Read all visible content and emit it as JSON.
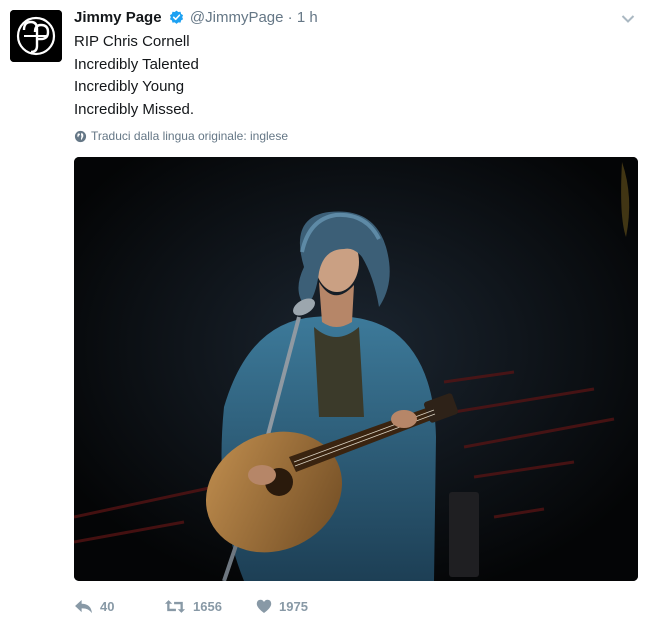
{
  "tweet": {
    "author_name": "Jimmy Page",
    "author_handle": "@JimmyPage",
    "separator": "·",
    "time": "1 h",
    "lines": [
      "RIP Chris Cornell",
      "Incredibly Talented",
      "Incredibly Young",
      "Incredibly Missed."
    ],
    "translate_label": "Traduci dalla lingua originale: inglese",
    "media_description": "",
    "actions": {
      "reply_count": "40",
      "retweet_count": "1656",
      "like_count": "1975"
    }
  },
  "colors": {
    "text": "#14171a",
    "secondary": "#657786",
    "action_icon": "#8899a6",
    "verified": "#1da1f2",
    "media_background": "#050608"
  },
  "icons": {
    "avatar": "jp-monogram",
    "verified": "verified-badge-icon",
    "caret": "chevron-down-icon",
    "translate": "globe-icon",
    "reply": "reply-icon",
    "retweet": "retweet-icon",
    "like": "heart-icon"
  }
}
